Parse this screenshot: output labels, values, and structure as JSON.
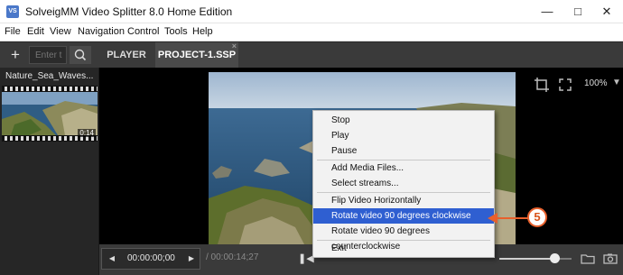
{
  "window": {
    "title": "SolveigMM Video Splitter 8.0 Home Edition",
    "app_icon": "VS",
    "controls": [
      "minimize-icon",
      "maximize-icon",
      "close-icon"
    ]
  },
  "menu": {
    "items": [
      "File",
      "Edit",
      "View",
      "Navigation",
      "Control",
      "Tools",
      "Help"
    ]
  },
  "toolbar": {
    "add_icon": "plus-icon",
    "search_placeholder": "Enter t",
    "search_icon": "search-icon",
    "tabs": [
      {
        "label": "PLAYER",
        "active": false
      },
      {
        "label": "PROJECT-1.SSP",
        "active": true,
        "close_glyph": "×"
      }
    ]
  },
  "media_panel": {
    "file_name": "Nature_Sea_Waves...",
    "duration": "0:14"
  },
  "viewer": {
    "crop_icon": "crop-icon",
    "fullscreen_icon": "fullscreen-icon",
    "zoom": "100%"
  },
  "transport": {
    "timecode": "00:00:00;00",
    "duration": "/ 00:00:14;27",
    "prev_icon": "triangle-left-icon",
    "next_icon": "triangle-right-icon",
    "playback_icon": "previous-frame-icon",
    "volume_level": 0.7,
    "folder_icon": "folder-icon",
    "snapshot_icon": "camera-icon"
  },
  "context_menu": {
    "groups": [
      [
        "Stop",
        "Play",
        "Pause"
      ],
      [
        "Add Media Files...",
        "Select streams..."
      ],
      [
        "Flip Video Horizontally",
        "Rotate video 90 degrees clockwise",
        "Rotate video 90 degrees counterclockwise"
      ],
      [
        "Exit"
      ]
    ],
    "highlighted": "Rotate video 90 degrees clockwise"
  },
  "annotation": {
    "step": "5",
    "color": "#e8602c"
  },
  "colors": {
    "menu_highlight": "#2f5fd1",
    "panel_dark": "#3a3a3a",
    "accent_orange": "#e8602c"
  }
}
